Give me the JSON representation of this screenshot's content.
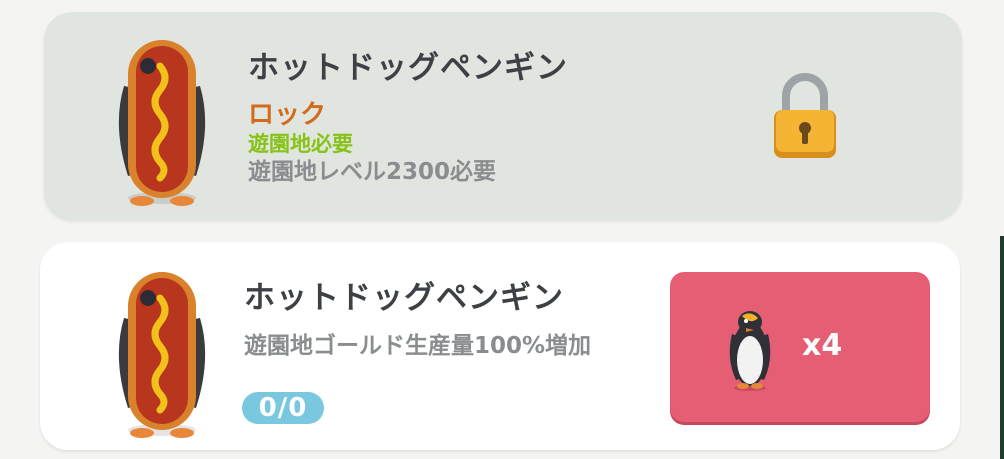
{
  "locked_card": {
    "title": "ホットドッグペンギン",
    "status": "ロック",
    "requirement": "遊園地必要",
    "level_requirement": "遊園地レベル2300必要",
    "icon": "padlock-icon"
  },
  "active_card": {
    "title": "ホットドッグペンギン",
    "description": "遊園地ゴールド生産量100%増加",
    "progress": "0/0",
    "cost_quantity": "x4",
    "cost_icon": "penguin-icon"
  },
  "colors": {
    "locked_bg": "#e1e5e0",
    "status_orange": "#d36a1c",
    "requirement_green": "#86c316",
    "button_red": "#e55e73",
    "badge_blue": "#7ac8e0"
  }
}
